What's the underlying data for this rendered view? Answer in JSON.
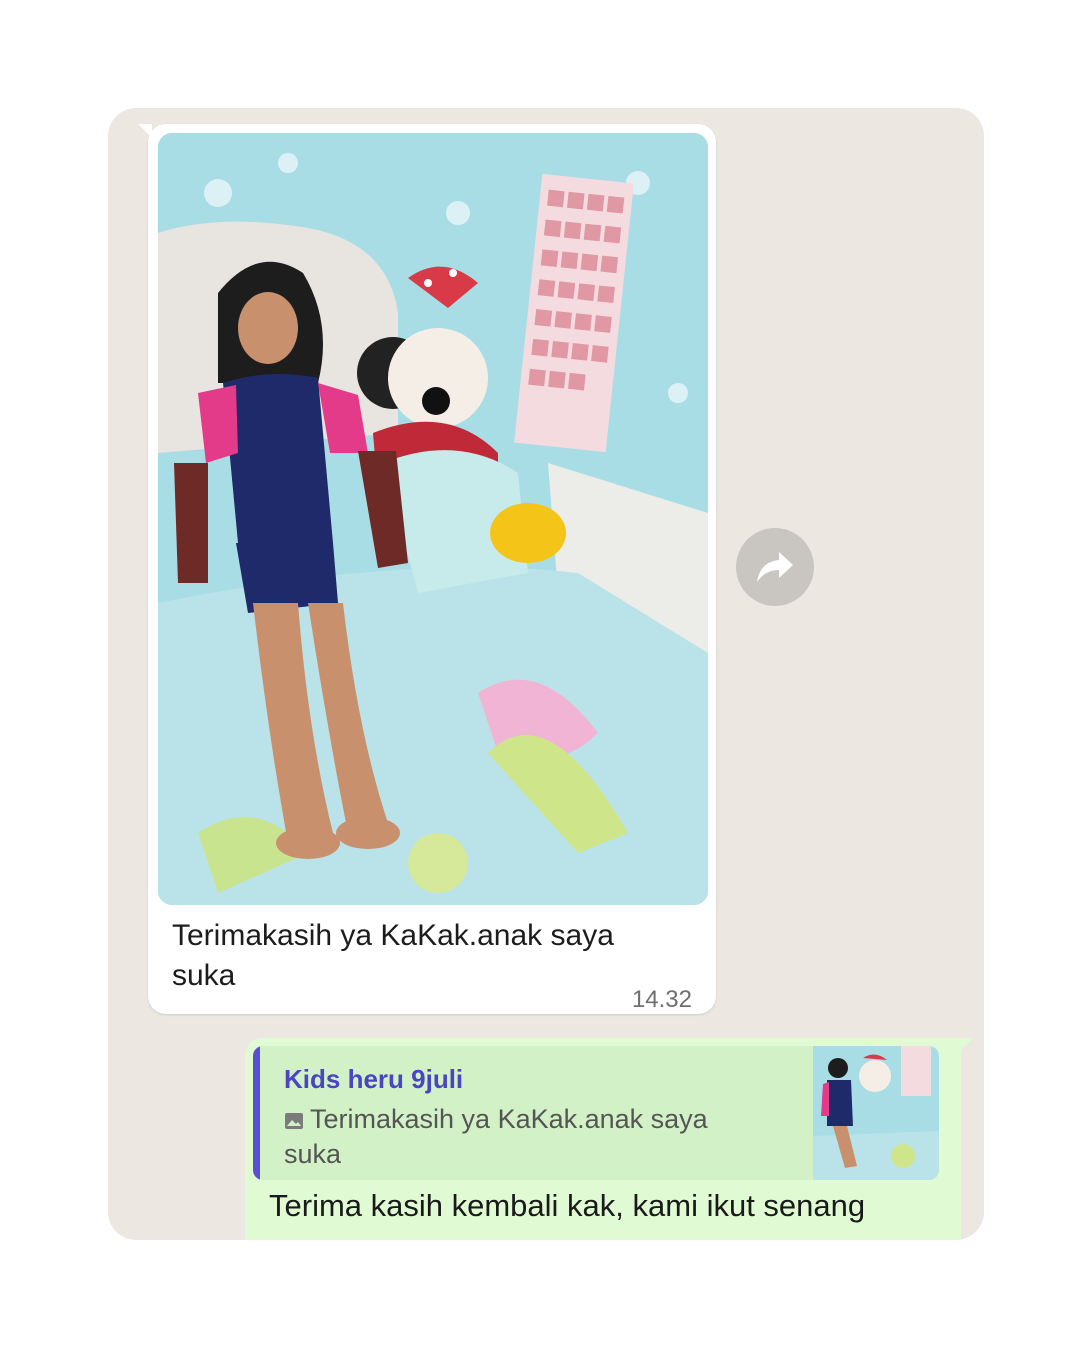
{
  "incoming_message": {
    "caption": "Terimakasih ya KaKak.anak saya suka",
    "time": "14.32",
    "photo_icon": "photo-attachment"
  },
  "forward": {
    "icon": "share-arrow-icon"
  },
  "outgoing_message": {
    "quote_author": "Kids heru 9juli",
    "quote_icon": "photo-icon",
    "quote_text": "Terimakasih ya KaKak.anak saya suka",
    "text": "Terima kasih kembali kak, kami ikut senang"
  },
  "colors": {
    "chat_background": "#ece8e1",
    "incoming_bubble": "#ffffff",
    "outgoing_bubble": "#e0fbd4",
    "quote_accent": "#5a4fd1"
  }
}
